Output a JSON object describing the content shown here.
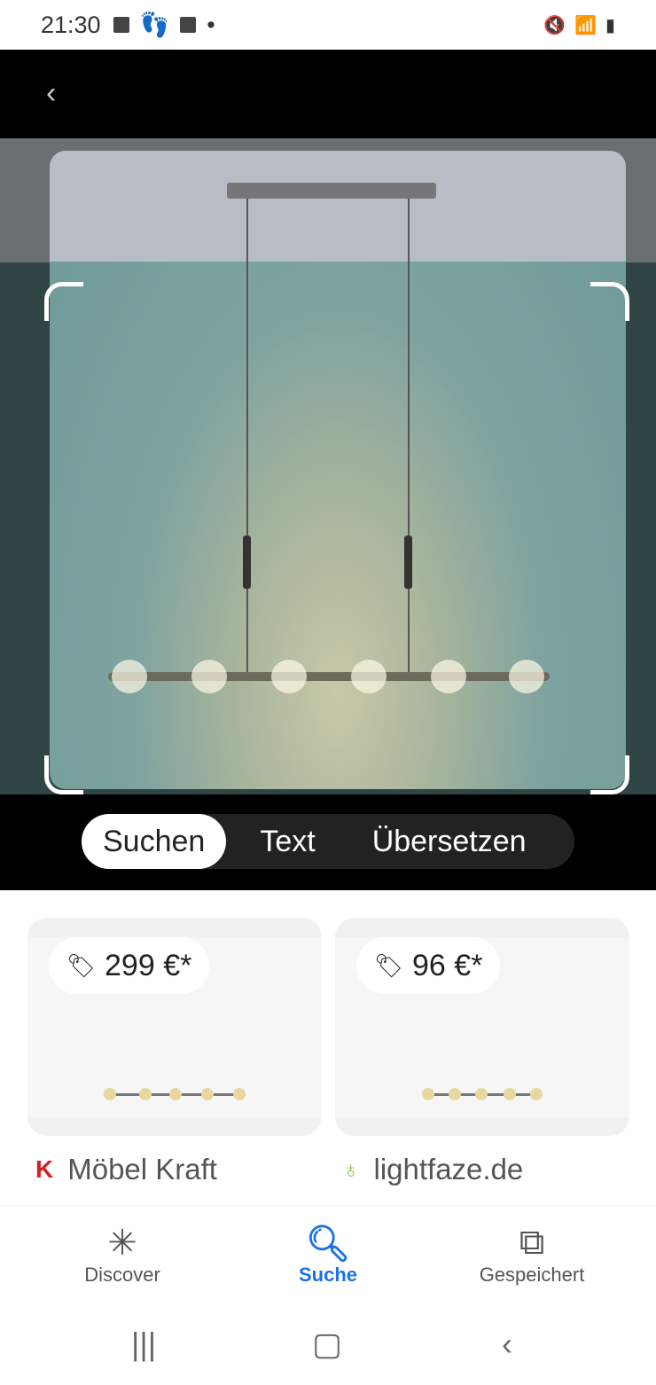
{
  "status_bar": {
    "time": "21:30"
  },
  "lens": {
    "modes": [
      {
        "label": "Suchen",
        "active": true
      },
      {
        "label": "Text",
        "active": false
      },
      {
        "label": "Übersetzen",
        "active": false
      }
    ]
  },
  "results": [
    {
      "price": "299 €*",
      "source": "Möbel Kraft",
      "icon": "moebel-kraft-logo"
    },
    {
      "price": "96 €*",
      "source": "lightfaze.de",
      "icon": "lightbulb-logo"
    }
  ],
  "bottom_nav": {
    "items": [
      {
        "label": "Discover",
        "icon": "asterisk-icon"
      },
      {
        "label": "Suche",
        "icon": "search-icon",
        "active": true
      },
      {
        "label": "Gespeichert",
        "icon": "bookmarks-icon"
      }
    ]
  },
  "colors": {
    "accent": "#1a73e8"
  }
}
